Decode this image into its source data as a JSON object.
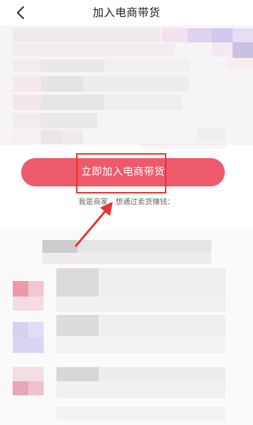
{
  "nav": {
    "title": "加入电商带货",
    "back_icon": "chevron-left-icon"
  },
  "cta": {
    "label": "立即加入电商带货",
    "color": "#ec5a6c"
  },
  "merchant_link": "我是商家，想通过卖货赚钱：",
  "annotation": {
    "color": "#e8352f",
    "arrow_icon": "arrow-icon"
  }
}
